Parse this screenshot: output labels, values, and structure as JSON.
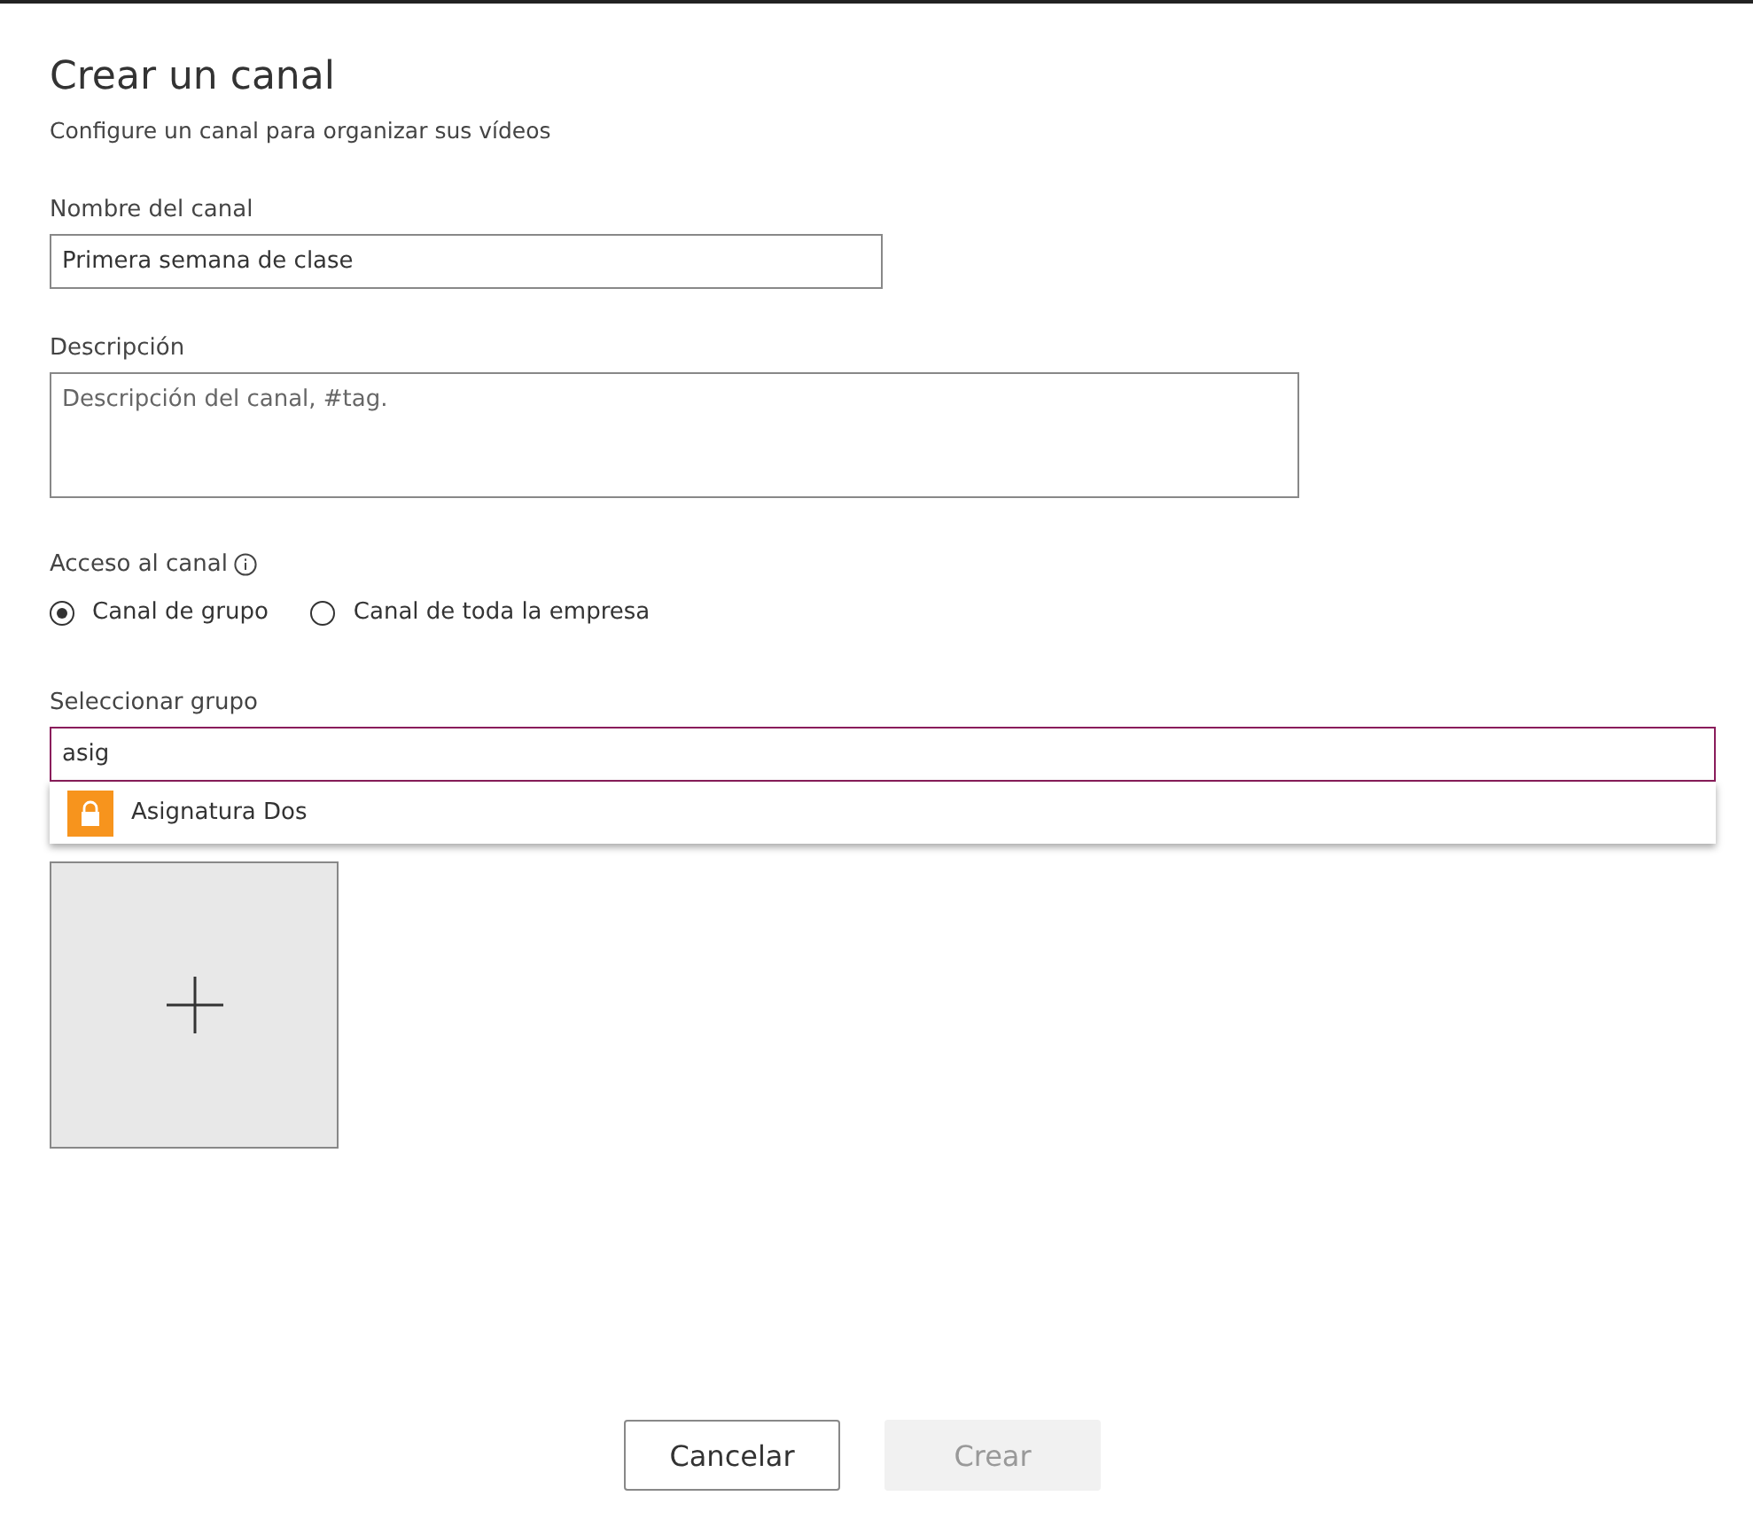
{
  "dialog": {
    "title": "Crear un canal",
    "subtitle": "Configure un canal para organizar sus vídeos"
  },
  "name_field": {
    "label": "Nombre del canal",
    "value": "Primera semana de clase"
  },
  "description_field": {
    "label": "Descripción",
    "placeholder": "Descripción del canal, #tag."
  },
  "access": {
    "label": "Acceso al canal",
    "options": [
      {
        "label": "Canal de grupo",
        "selected": true
      },
      {
        "label": "Canal de toda la empresa",
        "selected": false
      }
    ]
  },
  "group_field": {
    "label": "Seleccionar grupo",
    "value": "asig",
    "suggestions": [
      {
        "label": "Asignatura Dos",
        "color": "#f7941d"
      }
    ]
  },
  "buttons": [
    {
      "label": "Cancelar",
      "disabled": false
    },
    {
      "label": "Crear",
      "disabled": true
    }
  ]
}
